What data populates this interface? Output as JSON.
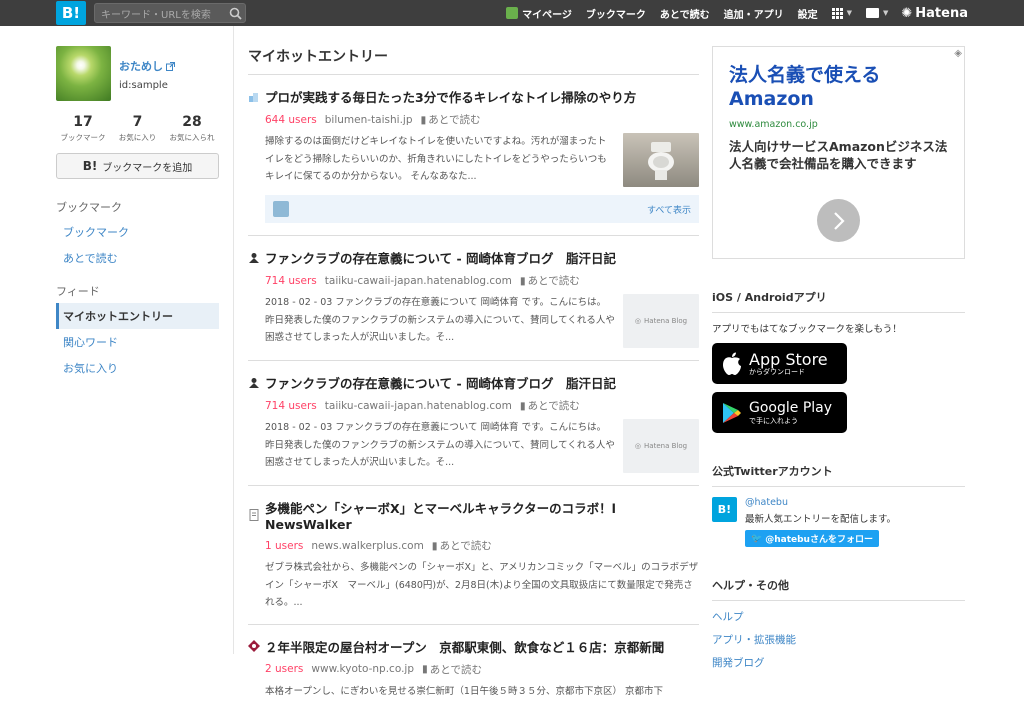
{
  "topbar": {
    "logo": "B!",
    "search_placeholder": "キーワード・URLを検索",
    "nav": [
      "マイページ",
      "ブックマーク",
      "あとで読む",
      "追加・アプリ",
      "設定"
    ],
    "brand": "Hatena"
  },
  "profile": {
    "name": "おためし",
    "id": "id:sample",
    "stats": [
      {
        "n": "17",
        "l": "ブックマーク"
      },
      {
        "n": "7",
        "l": "お気に入り"
      },
      {
        "n": "28",
        "l": "お気に入られ"
      }
    ],
    "add_bookmark": "ブックマークを追加",
    "add_bookmark_mark": "B!"
  },
  "sidebar": {
    "bookmark_title": "ブックマーク",
    "bookmark_items": [
      "ブックマーク",
      "あとで読む"
    ],
    "feed_title": "フィード",
    "feed_items": [
      "マイホットエントリー",
      "関心ワード",
      "お気に入り"
    ]
  },
  "main": {
    "title": "マイホットエントリー",
    "later_label": "あとで読む",
    "see_all": "すべて表示",
    "entries": [
      {
        "title": "プロが実践する毎日たった3分で作るキレイなトイレ掃除のやり方",
        "users": "644 users",
        "domain": "bilumen-taishi.jp",
        "text": "掃除するのは面倒だけどキレイなトイレを使いたいですよね。汚れが溜まったトイレをどう掃除したらいいのか、折角きれいにしたトイレをどうやったらいつもキレイに保てるのか分からない。 そんなあなた...",
        "thumb": "toilet"
      },
      {
        "title": "ファンクラブの存在意義について - 岡崎体育ブログ　脂汗日記",
        "users": "714 users",
        "domain": "taiiku-cawaii-japan.hatenablog.com",
        "text": "2018 - 02 - 03 ファンクラブの存在意義について 岡崎体育 です。こんにちは。 昨日発表した僕のファンクラブの新システムの導入について、賛同してくれる人や困惑させてしまった人が沢山いました。そ...",
        "thumb": "Hatena Blog"
      },
      {
        "title": "ファンクラブの存在意義について - 岡崎体育ブログ　脂汗日記",
        "users": "714 users",
        "domain": "taiiku-cawaii-japan.hatenablog.com",
        "text": "2018 - 02 - 03 ファンクラブの存在意義について 岡崎体育 です。こんにちは。 昨日発表した僕のファンクラブの新システムの導入について、賛同してくれる人や困惑させてしまった人が沢山いました。そ...",
        "thumb": "Hatena Blog"
      },
      {
        "title": "多機能ペン「シャーボX」とマーベルキャラクターのコラボ！l NewsWalker",
        "users": "1 users",
        "domain": "news.walkerplus.com",
        "text": "ゼブラ株式会社から、多機能ペンの「シャーボX」と、アメリカンコミック「マーベル」のコラボデザイン「シャーボX　マーベル」(6480円)が、2月8日(木)より全国の文具取扱店にて数量限定で発売される。..."
      },
      {
        "title": "２年半限定の屋台村オープン　京都駅東側、飲食など１６店：京都新聞",
        "users": "2 users",
        "domain": "www.kyoto-np.co.jp",
        "text": "本格オープンし、にぎわいを見せる崇仁新町（1日午後５時３５分、京都市下京区） 京都市下"
      }
    ]
  },
  "right": {
    "ad": {
      "headline": "法人名義で使えるAmazon",
      "url": "www.amazon.co.jp",
      "desc": "法人向けサービスAmazonビジネス法人名義で会社備品を購入できます"
    },
    "apps": {
      "title": "iOS / Androidアプリ",
      "text": "アプリでもはてなブックマークを楽しもう！",
      "appstore_big": "App Store",
      "appstore_small": "からダウンロード",
      "gplay_big": "Google Play",
      "gplay_small": "で手に入れよう"
    },
    "twitter": {
      "title": "公式Twitterアカウント",
      "handle": "@hatebu",
      "desc": "最新人気エントリーを配信します。",
      "follow": "@hatebuさんをフォロー",
      "logo": "B!"
    },
    "help": {
      "title": "ヘルプ・その他",
      "links": [
        "ヘルプ",
        "アプリ・拡張機能",
        "開発ブログ"
      ]
    }
  },
  "colors": {
    "accent": "#00a4de",
    "link": "#3e86c6",
    "users": "#ff4166",
    "topbar": "#3e3e3e"
  }
}
